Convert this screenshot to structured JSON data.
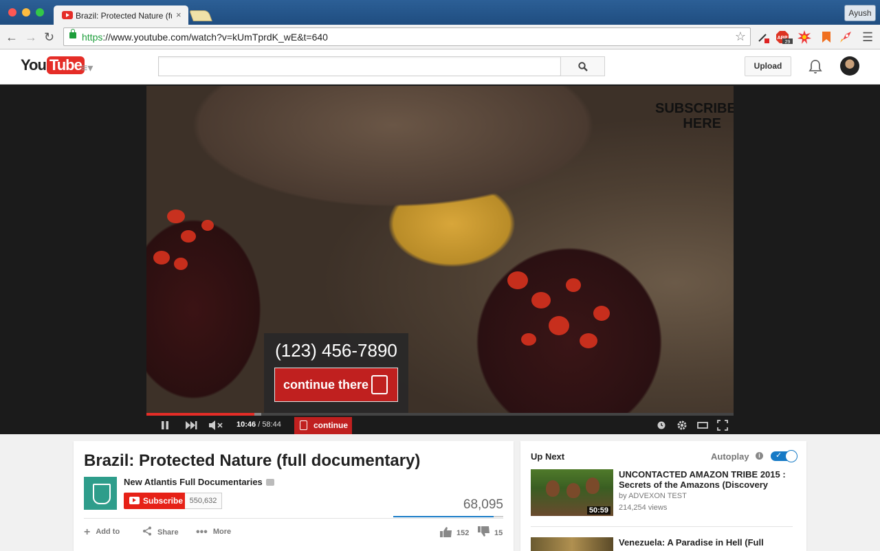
{
  "browser": {
    "tab_title": "Brazil: Protected Nature (fu",
    "tab_close": "×",
    "user_button": "Ayush",
    "url_https": "https",
    "url_rest": "://www.youtube.com/watch?v=kUmTprdK_wE&t=640",
    "extension_badge": "29"
  },
  "masthead": {
    "logo_you": "You",
    "logo_tube": "Tube",
    "search_placeholder": "",
    "upload_label": "Upload"
  },
  "player": {
    "watermark_line1": "SUBSCRIBE",
    "watermark_line2": "HERE",
    "overlay_phone": "(123) 456-7890",
    "overlay_cta": "continue there",
    "time_current": "10:46",
    "time_sep": " / ",
    "time_total": "58:44",
    "continue_button": "continue",
    "progress_fraction": 0.1835,
    "buffered_fraction": 0.195
  },
  "video": {
    "title": "Brazil: Protected Nature (full documentary)",
    "channel_name": "New Atlantis Full Documentaries",
    "subscribe_label": "Subscribe",
    "subscriber_count": "550,632",
    "view_count": "68,095",
    "add_to_label": "Add to",
    "share_label": "Share",
    "more_label": "More",
    "like_count": "152",
    "dislike_count": "15",
    "like_fraction": 0.91
  },
  "sidebar": {
    "up_next_label": "Up Next",
    "autoplay_label": "Autoplay",
    "autoplay_on": true,
    "items": [
      {
        "title": "UNCONTACTED AMAZON TRIBE 2015 : Secrets of the Amazons (Discovery",
        "channel": "by ADVEXON TEST",
        "views": "214,254 views",
        "duration": "50:59"
      },
      {
        "title": "Venezuela: A Paradise in Hell (Full",
        "channel": "",
        "views": "",
        "duration": ""
      }
    ]
  },
  "colors": {
    "youtube_red": "#e52d27",
    "link_blue": "#167ac6",
    "secure_green": "#1d9e3b"
  }
}
